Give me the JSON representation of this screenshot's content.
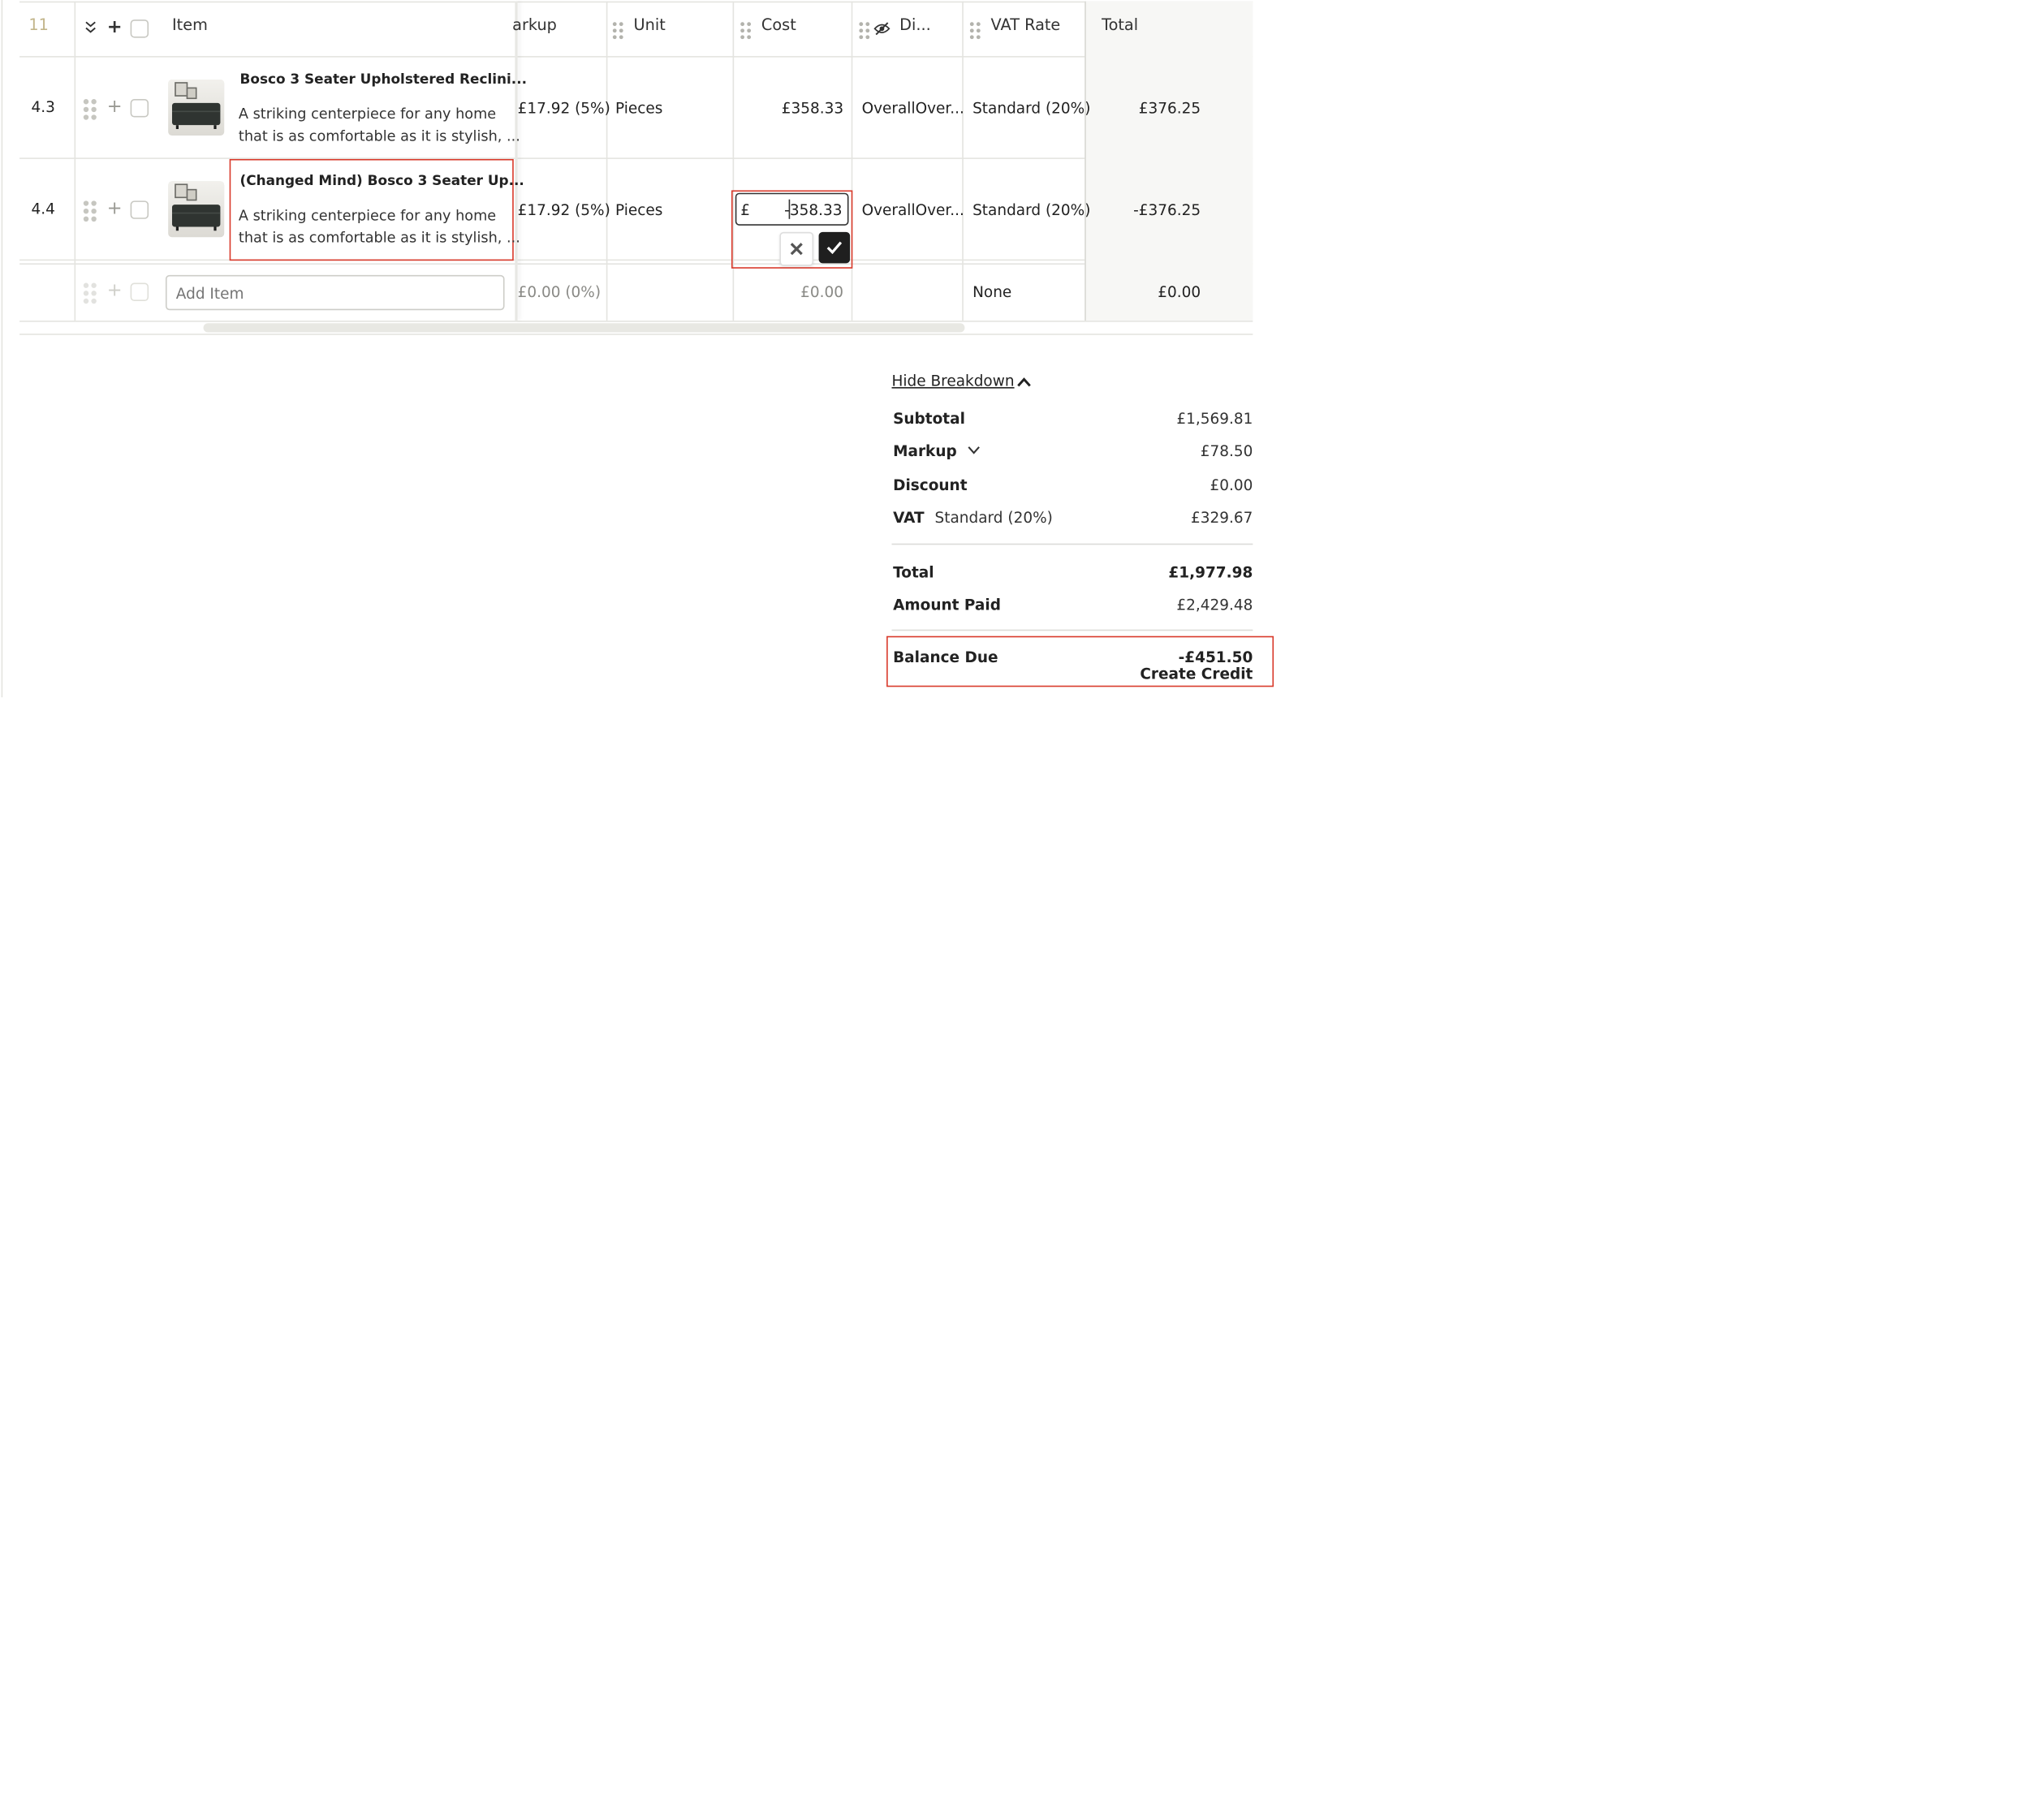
{
  "header": {
    "row_count": "11",
    "item": "Item",
    "markup": "arkup",
    "unit": "Unit",
    "cost": "Cost",
    "discount": "Di...",
    "vat_rate": "VAT Rate",
    "total": "Total"
  },
  "rows": [
    {
      "num": "4.3",
      "title": "Bosco 3 Seater Upholstered Reclini...",
      "desc1": "A striking centerpiece for any home",
      "desc2": "that is as comfortable as it is stylish, ...",
      "markup": "£17.92 (5%)",
      "unit": "Pieces",
      "cost": "£358.33",
      "discount": "OverallOver...",
      "vat": "Standard (20%)",
      "total": "£376.25"
    },
    {
      "num": "4.4",
      "title": "(Changed Mind) Bosco 3 Seater Up...",
      "desc1": "A striking centerpiece for any home",
      "desc2": "that is as comfortable as it is stylish, ...",
      "markup": "£17.92 (5%)",
      "unit": "Pieces",
      "cost_currency": "£",
      "cost_value": "-358.33",
      "discount": "OverallOver...",
      "vat": "Standard (20%)",
      "total": "-£376.25"
    }
  ],
  "add_row": {
    "placeholder": "Add Item",
    "markup": "£0.00 (0%)",
    "cost": "£0.00",
    "vat": "None",
    "total": "£0.00"
  },
  "summary": {
    "toggle": "Hide Breakdown",
    "subtotal_label": "Subtotal",
    "subtotal": "£1,569.81",
    "markup_label": "Markup",
    "markup": "£78.50",
    "discount_label": "Discount",
    "discount": "£0.00",
    "vat_label": "VAT",
    "vat_type": "Standard (20%)",
    "vat": "£329.67",
    "total_label": "Total",
    "total": "£1,977.98",
    "paid_label": "Amount Paid",
    "paid": "£2,429.48",
    "balance_label": "Balance Due",
    "balance": "-£451.50",
    "create_credit": "Create Credit"
  },
  "colors": {
    "highlight_red": "#d93a2b",
    "confirm_dark": "#1f1f1f",
    "border": "#e4e4e0",
    "sofa": "#2f3431"
  },
  "icons": [
    "collapse-all-icon",
    "plus-icon",
    "drag-handle-icon",
    "eye-off-icon",
    "chevron-up-icon",
    "chevron-down-icon",
    "close-icon",
    "check-icon"
  ]
}
